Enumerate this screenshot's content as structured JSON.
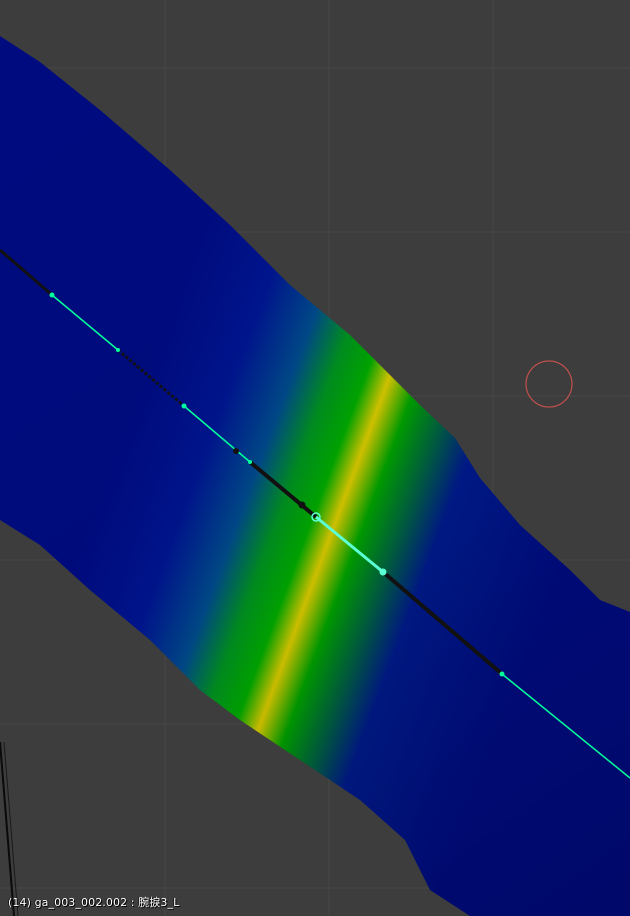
{
  "viewport": {
    "status_text": "(14) ga_003_002.002 : 腕捩3_L"
  },
  "colors": {
    "background": "#3d3d3d",
    "grid_line": "#474747",
    "weight_low": "#000b80",
    "weight_mid": "#00a000",
    "weight_high": "#e0c800",
    "bone_selected": "#00ff9c",
    "bone_active": "#5cffd4",
    "bone_line": "#111111",
    "cursor_ring": "#c0504d"
  },
  "icons": {
    "cursor": "3d-cursor-icon"
  }
}
